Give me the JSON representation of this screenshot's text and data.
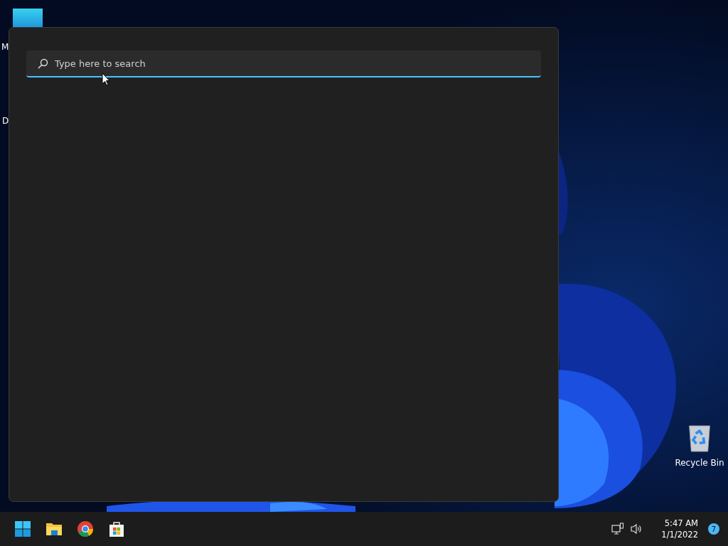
{
  "desktop": {
    "icons": [
      {
        "kind": "app",
        "label": "M"
      },
      {
        "kind": "hidden",
        "label": "D"
      },
      {
        "kind": "recycle-bin",
        "label": "Recycle Bin"
      }
    ]
  },
  "search_panel": {
    "placeholder": "Type here to search",
    "focused": true
  },
  "taskbar": {
    "pinned": [
      {
        "kind": "start"
      },
      {
        "kind": "explorer"
      },
      {
        "kind": "chrome"
      },
      {
        "kind": "store"
      }
    ],
    "tray": {
      "time": "5:47 AM",
      "date": "1/1/2022",
      "notifications": "7"
    }
  }
}
